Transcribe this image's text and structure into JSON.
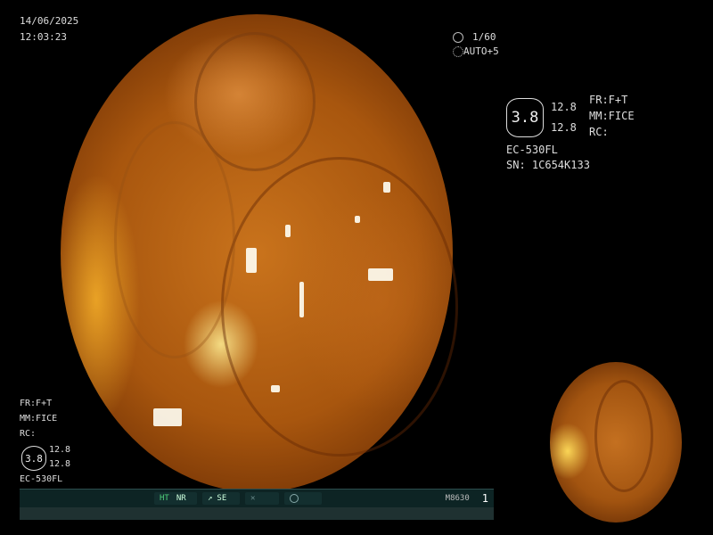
{
  "header": {
    "date": "14/06/2025",
    "time": "12:03:23"
  },
  "exposure": {
    "shutter_icon": "shutter-icon",
    "shutter": "1/60",
    "auto_icon": "auto-iris-icon",
    "auto": "AUTO+5"
  },
  "settings_right": {
    "fr": "FR:F+T",
    "mm": "MM:FICE",
    "rc": "RC:",
    "zoom": "3.8",
    "value1": "12.8",
    "value2": "12.8",
    "scope": "EC-530FL",
    "serial": "SN: 1C654K133"
  },
  "settings_left": {
    "fr": "FR:F+T",
    "mm": "MM:FICE",
    "rc": "RC:",
    "zoom": "3.8",
    "value1": "12.8",
    "value2": "12.8",
    "scope": "EC-530FL"
  },
  "statusbar": {
    "ht": "HT",
    "nr": "NR",
    "se": "SE",
    "model": "M8630",
    "index": "1"
  },
  "colors": {
    "background": "#000000",
    "statusbar": "#0d2424",
    "ht_label": "#4fd27a",
    "tissue_main": "#c9731c"
  }
}
